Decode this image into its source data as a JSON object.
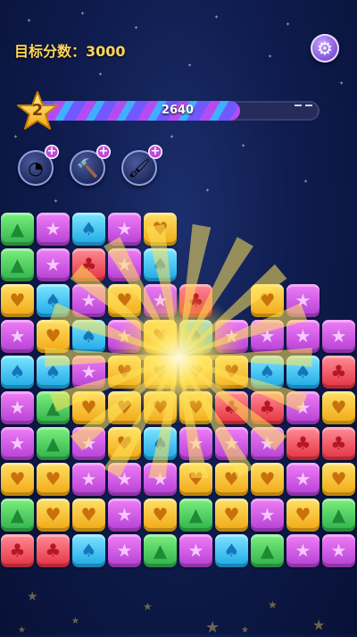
{
  "header": {
    "target_label": "目标分数：3000"
  },
  "settings": {
    "icon": "gear-icon"
  },
  "progress": {
    "level": "2",
    "score": "2640",
    "target": 3000,
    "fill_fraction": 0.72
  },
  "tools": [
    {
      "name": "refresh-tool",
      "icon": "rainbow-ring-icon",
      "plus": "+"
    },
    {
      "name": "hammer-tool",
      "icon": "hammer-icon",
      "plus": "+"
    },
    {
      "name": "brush-tool",
      "icon": "paintbrush-icon",
      "plus": "+"
    }
  ],
  "board": {
    "colors": {
      "g": "#3ccc5a",
      "p": "#c84fe4",
      "b": "#2ab8f2",
      "r": "#ee4554",
      "y": "#f7c12a"
    },
    "rows": [
      [
        "g",
        "p",
        "b",
        "p",
        "y",
        "",
        "",
        "",
        "",
        ""
      ],
      [
        "g",
        "p",
        "r",
        "p",
        "b",
        "",
        "",
        "",
        "",
        ""
      ],
      [
        "y",
        "b",
        "p",
        "y",
        "p",
        "r",
        "",
        "y",
        "p",
        ""
      ],
      [
        "p",
        "y",
        "b",
        "p",
        "y",
        "b",
        "p",
        "p",
        "p",
        "p"
      ],
      [
        "b",
        "b",
        "p",
        "y",
        "y",
        "y",
        "y",
        "b",
        "b",
        "r"
      ],
      [
        "p",
        "g",
        "y",
        "y",
        "y",
        "y",
        "r",
        "r",
        "p",
        "y"
      ],
      [
        "p",
        "g",
        "p",
        "y",
        "b",
        "p",
        "p",
        "p",
        "r",
        "r"
      ],
      [
        "y",
        "y",
        "p",
        "p",
        "p",
        "y",
        "y",
        "y",
        "p",
        "y"
      ],
      [
        "g",
        "y",
        "y",
        "p",
        "y",
        "g",
        "y",
        "p",
        "y",
        "g"
      ],
      [
        "r",
        "r",
        "b",
        "p",
        "g",
        "p",
        "b",
        "g",
        "p",
        "p"
      ]
    ]
  }
}
